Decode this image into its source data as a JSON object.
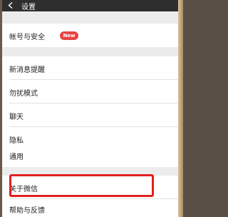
{
  "header": {
    "title": "设置"
  },
  "groups": [
    {
      "items": [
        {
          "label": "帐号与安全",
          "badge": "New"
        }
      ]
    },
    {
      "items": [
        {
          "label": "新消息提醒"
        },
        {
          "label": "勿扰模式"
        },
        {
          "label": "聊天"
        },
        {
          "label": "隐私"
        },
        {
          "label": "通用"
        }
      ]
    },
    {
      "items": [
        {
          "label": "关于微信"
        },
        {
          "label": "帮助与反馈"
        }
      ]
    }
  ],
  "colors": {
    "header_bg": "#2e2e2e",
    "badge_bg": "#e64340",
    "highlight_border": "#e32020",
    "background": "#ececec"
  }
}
